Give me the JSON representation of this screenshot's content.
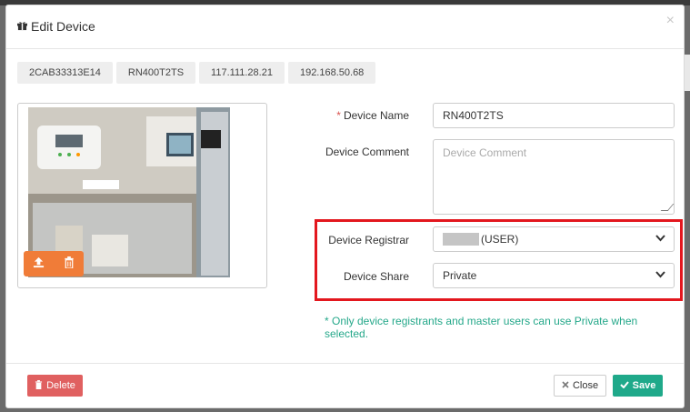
{
  "modal": {
    "title": "Edit Device",
    "close_symbol": "×"
  },
  "chips": [
    "2CAB33313E14",
    "RN400T2TS",
    "117.111.28.21",
    "192.168.50.68"
  ],
  "form": {
    "device_name": {
      "label": "Device Name",
      "required_mark": "*",
      "value": "RN400T2TS"
    },
    "device_comment": {
      "label": "Device Comment",
      "placeholder": "Device Comment"
    },
    "device_registrar": {
      "label": "Device Registrar",
      "value": "(USER)"
    },
    "device_share": {
      "label": "Device Share",
      "value": "Private"
    }
  },
  "note": "* Only device registrants and master users can use Private when selected.",
  "buttons": {
    "delete": "Delete",
    "close": "Close",
    "save": "Save"
  },
  "icons": {
    "title": "gift-icon",
    "upload": "upload-icon",
    "trash": "trash-icon",
    "chevron": "chevron-down-icon",
    "check": "check-icon",
    "x": "x-icon"
  },
  "colors": {
    "save": "#1fa98a",
    "delete": "#e06060",
    "upload": "#f07c38",
    "highlight": "#e3171e",
    "note": "#25a88a"
  }
}
